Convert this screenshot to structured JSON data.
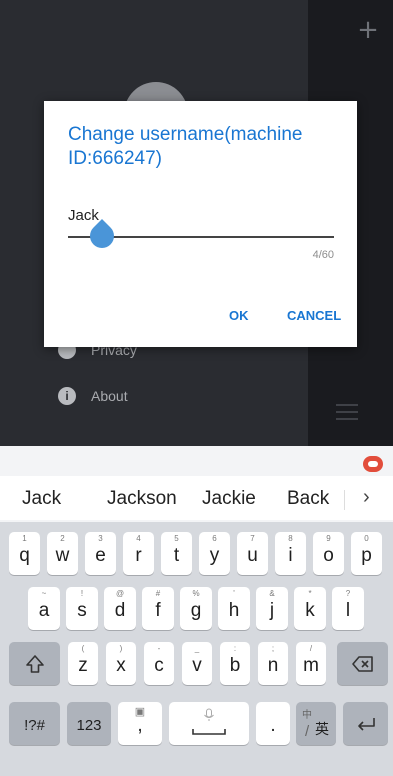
{
  "app": {
    "menu": [
      {
        "label": "Privacy",
        "icon": "privacy-icon"
      },
      {
        "label": "About",
        "icon": "info-icon",
        "icon_glyph": "i"
      }
    ]
  },
  "dialog": {
    "title": "Change username(machine ID:666247)",
    "input_value": "Jack",
    "counter": "4/60",
    "ok_label": "OK",
    "cancel_label": "CANCEL"
  },
  "keyboard": {
    "suggestions": [
      "Jack",
      "Jackson",
      "Jackie",
      "Back"
    ],
    "row1": [
      {
        "k": "q",
        "s": "1"
      },
      {
        "k": "w",
        "s": "2"
      },
      {
        "k": "e",
        "s": "3"
      },
      {
        "k": "r",
        "s": "4"
      },
      {
        "k": "t",
        "s": "5"
      },
      {
        "k": "y",
        "s": "6"
      },
      {
        "k": "u",
        "s": "7"
      },
      {
        "k": "i",
        "s": "8"
      },
      {
        "k": "o",
        "s": "9"
      },
      {
        "k": "p",
        "s": "0"
      }
    ],
    "row2": [
      {
        "k": "a",
        "s": "~"
      },
      {
        "k": "s",
        "s": "!"
      },
      {
        "k": "d",
        "s": "@"
      },
      {
        "k": "f",
        "s": "#"
      },
      {
        "k": "g",
        "s": "%"
      },
      {
        "k": "h",
        "s": "'"
      },
      {
        "k": "j",
        "s": "&"
      },
      {
        "k": "k",
        "s": "*"
      },
      {
        "k": "l",
        "s": "?"
      }
    ],
    "row3": [
      {
        "k": "z",
        "s": "("
      },
      {
        "k": "x",
        "s": ")"
      },
      {
        "k": "c",
        "s": "-"
      },
      {
        "k": "v",
        "s": "_"
      },
      {
        "k": "b",
        "s": ":"
      },
      {
        "k": "n",
        "s": ";"
      },
      {
        "k": "m",
        "s": "/"
      }
    ],
    "sym_label": "!?#",
    "num_label": "123",
    "comma_label": ",",
    "period_label": ".",
    "lang_label": "英",
    "lang_sup": "中"
  }
}
